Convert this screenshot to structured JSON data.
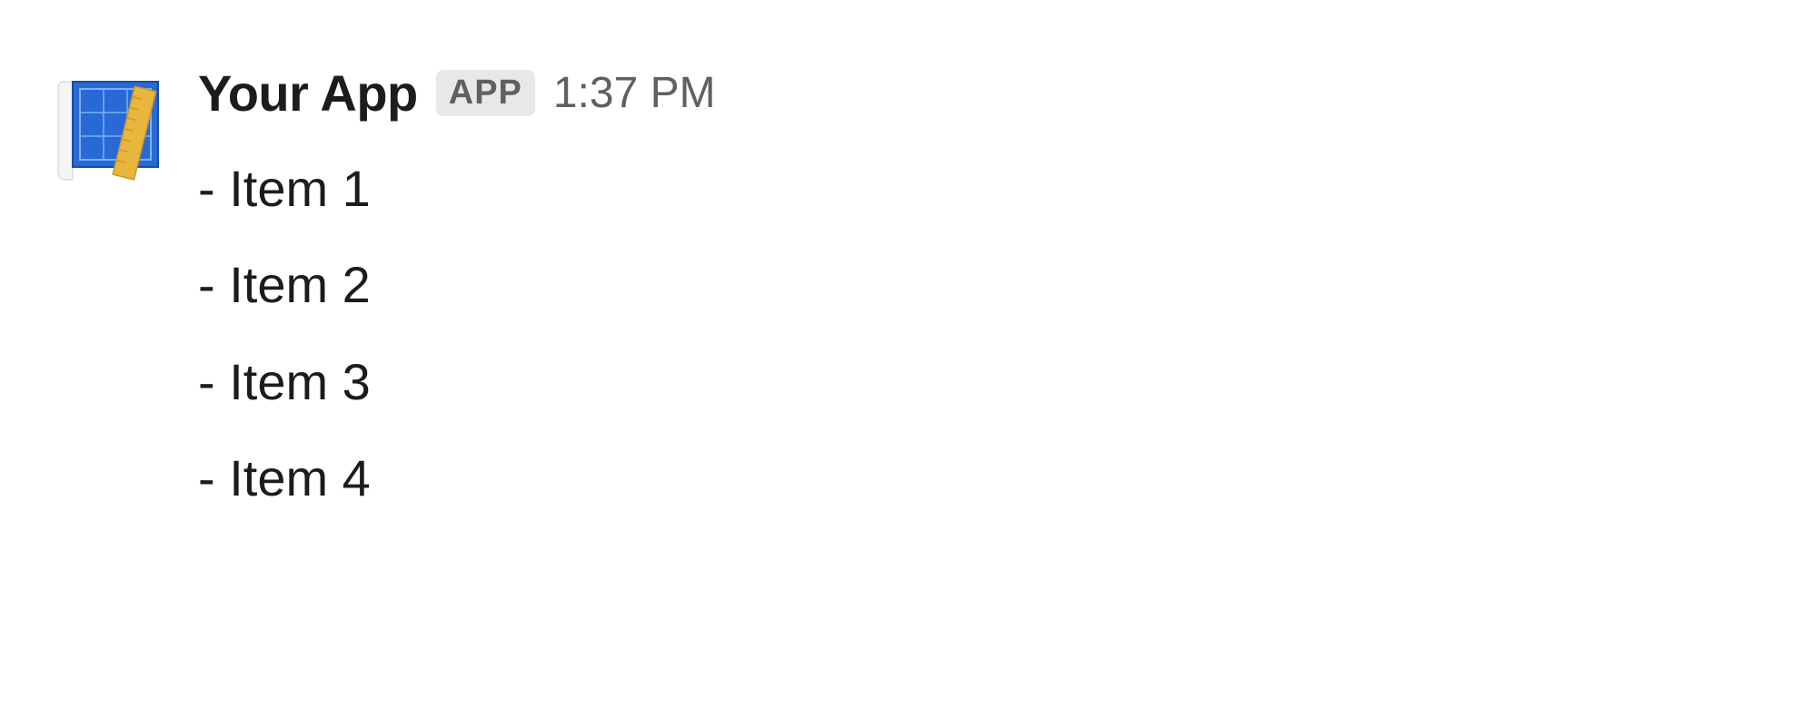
{
  "message": {
    "sender": "Your App",
    "badge": "APP",
    "timestamp": "1:37 PM",
    "items": [
      "- Item 1",
      "- Item 2",
      "- Item 3",
      "- Item 4"
    ]
  }
}
